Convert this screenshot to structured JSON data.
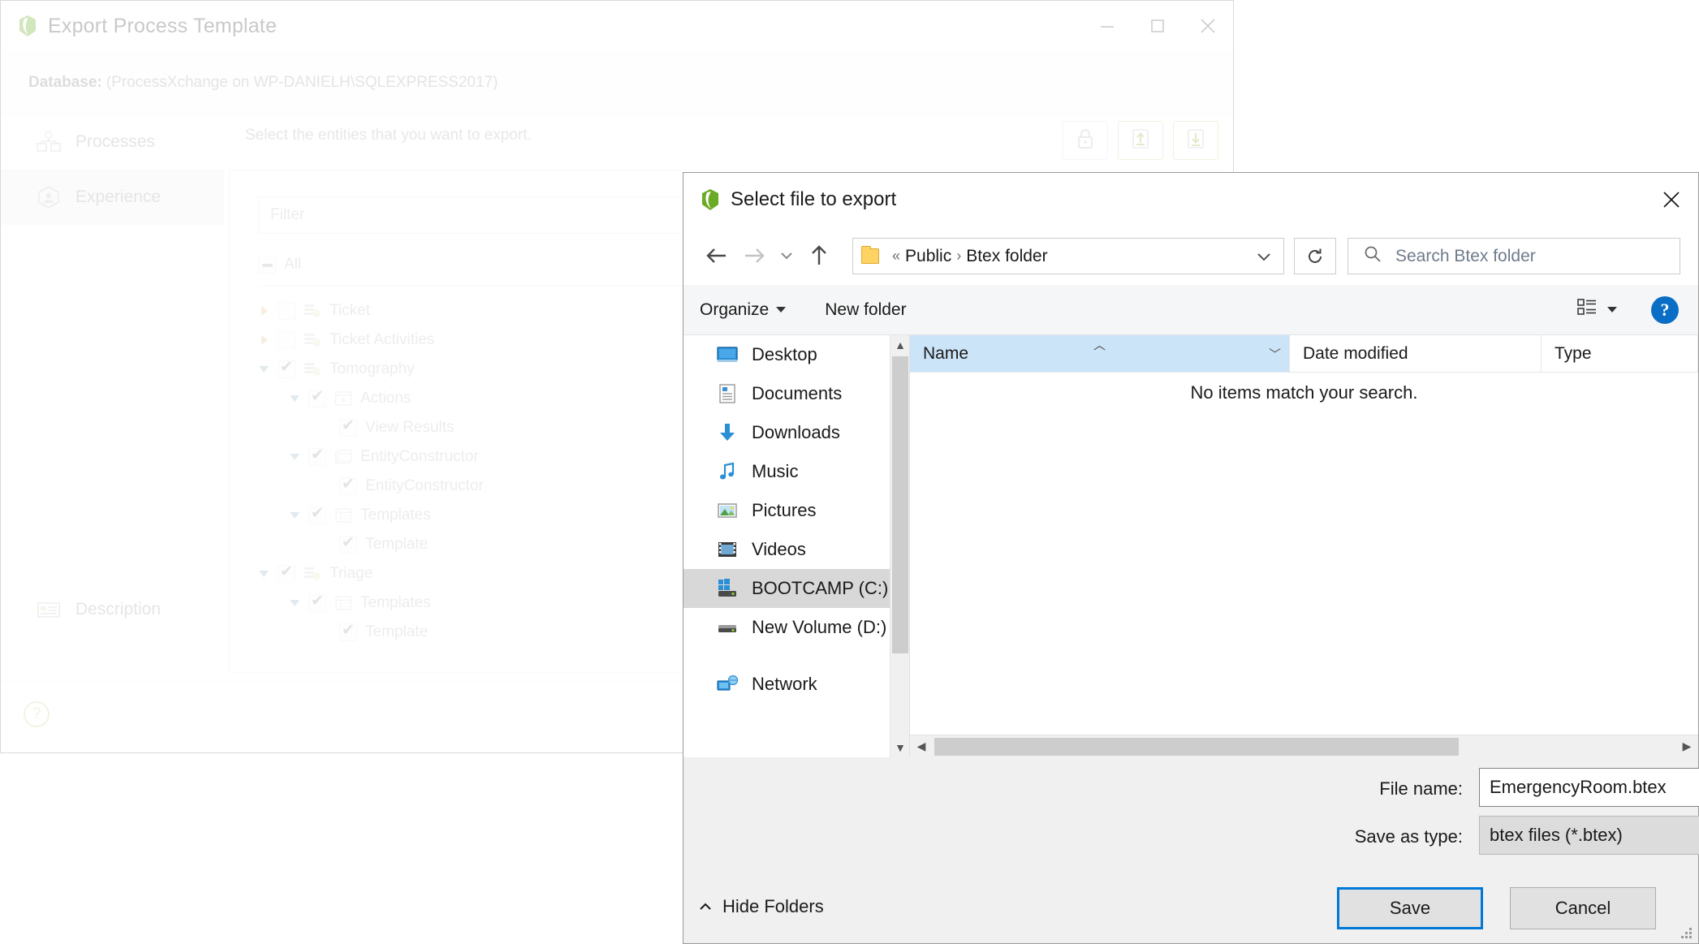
{
  "bg_window": {
    "title": "Export Process Template",
    "logo_icon": "green-leaf-logo-icon",
    "minimize_icon": "minimize-icon",
    "maximize_icon": "maximize-icon",
    "close_icon": "close-icon",
    "database_label": "Database:",
    "database_value": "(ProcessXchange on WP-DANIELH\\SQLEXPRESS2017)",
    "sidebar": {
      "items": [
        {
          "label": "Processes",
          "icon": "org-chart-icon",
          "active": false
        },
        {
          "label": "Experience",
          "icon": "hexagon-person-icon",
          "active": true
        }
      ],
      "description_item": {
        "label": "Description",
        "icon": "description-card-icon"
      }
    },
    "main": {
      "hint": "Select the entities that you want to export.",
      "toolbar": [
        {
          "name": "lock-button",
          "icon": "lock-icon"
        },
        {
          "name": "import-button",
          "icon": "arrow-up-into-tray-icon"
        },
        {
          "name": "export-button",
          "icon": "arrow-down-into-tray-icon"
        }
      ],
      "filter_placeholder": "Filter",
      "all_label": "All",
      "tree": [
        {
          "label": "Ticket",
          "indent": 0,
          "arrow": "right",
          "check": "unchecked",
          "icon": "entity-icon"
        },
        {
          "label": "Ticket Activities",
          "indent": 0,
          "arrow": "right",
          "check": "unchecked",
          "icon": "entity-icon"
        },
        {
          "label": "Tomography",
          "indent": 0,
          "arrow": "down",
          "check": "checked",
          "icon": "entity-icon"
        },
        {
          "label": "Actions",
          "indent": 1,
          "arrow": "down",
          "check": "checked",
          "icon": "window-action-icon"
        },
        {
          "label": "View Results",
          "indent": 2,
          "arrow": "none",
          "check": "checked",
          "icon": "none"
        },
        {
          "label": "EntityConstructor",
          "indent": 1,
          "arrow": "down",
          "check": "checked",
          "icon": "constructor-icon"
        },
        {
          "label": "EntityConstructor",
          "indent": 2,
          "arrow": "none",
          "check": "checked",
          "icon": "none"
        },
        {
          "label": "Templates",
          "indent": 1,
          "arrow": "down",
          "check": "checked",
          "icon": "template-icon"
        },
        {
          "label": "Template",
          "indent": 2,
          "arrow": "none",
          "check": "checked",
          "icon": "none"
        },
        {
          "label": "Triage",
          "indent": 0,
          "arrow": "down",
          "check": "checked",
          "icon": "entity-icon"
        },
        {
          "label": "Templates",
          "indent": 1,
          "arrow": "down",
          "check": "checked",
          "icon": "template-icon"
        },
        {
          "label": "Template",
          "indent": 2,
          "arrow": "none",
          "check": "checked",
          "icon": "none"
        }
      ],
      "watermark_icon": "green-hexagon-cube-icon"
    },
    "footer": {
      "help_label": "?",
      "help_icon": "question-mark-icon"
    }
  },
  "dialog": {
    "title": "Select file to export",
    "logo_icon": "green-leaf-logo-icon",
    "close_icon": "close-icon",
    "nav": {
      "back_icon": "arrow-left-icon",
      "forward_icon": "arrow-right-icon",
      "recent_icon": "chevron-down-icon",
      "up_icon": "arrow-up-icon",
      "folder_icon": "folder-icon",
      "breadcrumb_overflow": "«",
      "breadcrumb": [
        "Public",
        "Btex folder"
      ],
      "breadcrumb_separator": "›",
      "address_dropdown_icon": "chevron-down-icon",
      "refresh_icon": "refresh-icon"
    },
    "search": {
      "icon": "search-icon",
      "placeholder": "Search Btex folder"
    },
    "toolbar": {
      "organize_label": "Organize",
      "organize_caret_icon": "caret-down-icon",
      "new_folder_label": "New folder",
      "view_icon": "view-layout-icon",
      "view_caret_icon": "caret-down-icon",
      "help_icon": "help-circle-icon",
      "help_label": "?"
    },
    "nav_pane": {
      "scroll_up_icon": "chevron-up-icon",
      "scroll_down_icon": "chevron-down-icon",
      "items": [
        {
          "label": "Desktop",
          "icon": "desktop-icon",
          "selected": false
        },
        {
          "label": "Documents",
          "icon": "documents-icon",
          "selected": false
        },
        {
          "label": "Downloads",
          "icon": "downloads-icon",
          "selected": false
        },
        {
          "label": "Music",
          "icon": "music-icon",
          "selected": false
        },
        {
          "label": "Pictures",
          "icon": "pictures-icon",
          "selected": false
        },
        {
          "label": "Videos",
          "icon": "videos-icon",
          "selected": false
        },
        {
          "label": "BOOTCAMP (C:)",
          "icon": "drive-windows-icon",
          "selected": true
        },
        {
          "label": "New Volume (D:)",
          "icon": "drive-icon",
          "selected": false
        },
        {
          "label": "Network",
          "icon": "network-icon",
          "selected": false
        }
      ]
    },
    "file_list": {
      "columns": [
        {
          "label": "Name",
          "sorted": true,
          "sort_icon": "sort-ascending-icon",
          "chevron_icon": "chevron-down-icon"
        },
        {
          "label": "Date modified",
          "sorted": false
        },
        {
          "label": "Type",
          "sorted": false
        }
      ],
      "empty_message": "No items match your search.",
      "hscroll_left_icon": "chevron-left-icon",
      "hscroll_right_icon": "chevron-right-icon"
    },
    "fields": {
      "file_name_label": "File name:",
      "file_name_value": "EmergencyRoom.btex",
      "file_name_chevron_icon": "chevron-down-icon",
      "save_as_type_label": "Save as type:",
      "save_as_type_value": "btex files (*.btex)",
      "save_as_type_chevron_icon": "chevron-down-icon"
    },
    "actions": {
      "hide_folders_label": "Hide Folders",
      "hide_folders_icon": "chevron-up-icon",
      "save_label": "Save",
      "cancel_label": "Cancel",
      "resize_grip_icon": "resize-grip-icon"
    }
  },
  "colors": {
    "brand_green": "#5b8c1f",
    "accent_blue": "#0078d7",
    "selection_blue": "#cce4f7",
    "nav_selected_gray": "#d8d8d8",
    "folder_yellow": "#ffd264"
  }
}
